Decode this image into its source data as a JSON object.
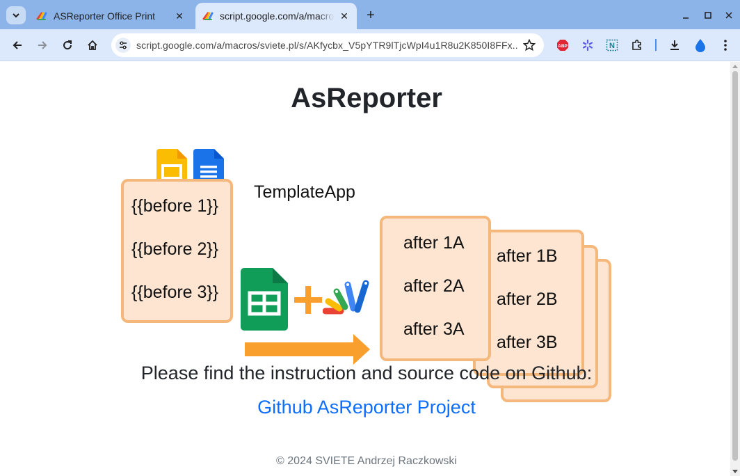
{
  "browser": {
    "tabs": [
      {
        "title": "ASReporter Office Print",
        "active": false
      },
      {
        "title": "script.google.com/a/macros/sviete.pl/s/AKfycbx",
        "active": true
      }
    ],
    "address": "script.google.com/a/macros/sviete.pl/s/AKfycbx_V5pYTR9lTjcWpI4u1R8u2K850I8FFx...",
    "extensions": [
      "adblock-icon",
      "snowflake-extension-icon",
      "n-extension-icon",
      "puzzle-icon"
    ],
    "extension_labels": {
      "abp": "ABP",
      "n": "N"
    }
  },
  "page": {
    "title": "AsReporter",
    "illustration": {
      "before": [
        "{{before 1}}",
        "{{before 2}}",
        "{{before 3}}"
      ],
      "app_label": "TemplateApp",
      "after_a": [
        "after 1A",
        "after 2A",
        "after 3A"
      ],
      "after_b": [
        "after 1B",
        "after 2B",
        "after 3B"
      ]
    },
    "instruction": "Please find the instruction and source code on Github:",
    "github_link": "Github AsReporter Project",
    "footer": "© 2024 SVIETE Andrzej Raczkowski"
  },
  "colors": {
    "card_fill": "#fde5d1",
    "card_border": "#f5b87c",
    "arrow": "#f99f2e",
    "link": "#0d6efd",
    "tabbar": "#8cb4e8",
    "toolbar": "#dce8fb"
  }
}
